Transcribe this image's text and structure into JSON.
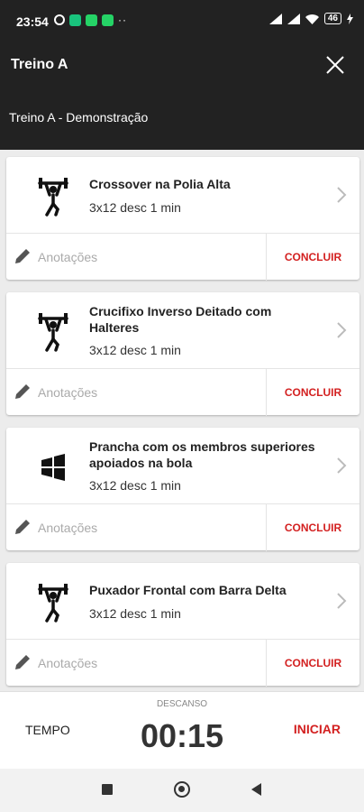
{
  "status_bar": {
    "time": "23:54",
    "battery": "46",
    "icons": [
      "alarm-icon",
      "green-app-icon",
      "whatsapp-icon",
      "whatsapp-icon",
      "more-dots",
      "signal-icon",
      "signal-icon",
      "wifi-icon",
      "battery-icon",
      "charging-icon"
    ]
  },
  "header": {
    "title": "Treino A",
    "subtitle": "Treino A - Demonstração"
  },
  "exercises": [
    {
      "name": "Crossover na Polia Alta",
      "detail": "3x12 desc 1 min",
      "notes_placeholder": "Anotações",
      "action": "CONCLUIR",
      "icon": "weightlifter-icon"
    },
    {
      "name": "Crucifixo Inverso Deitado  com Halteres",
      "detail": "3x12 desc 1 min",
      "notes_placeholder": "Anotações",
      "action": "CONCLUIR",
      "icon": "weightlifter-icon"
    },
    {
      "name": "Prancha com os membros superiores apoiados na bola",
      "detail": "3x12 desc 1 min",
      "notes_placeholder": "Anotações",
      "action": "CONCLUIR",
      "icon": "windows-grid-icon"
    },
    {
      "name": "Puxador Frontal com Barra Delta",
      "detail": "3x12 desc 1 min",
      "notes_placeholder": "Anotações",
      "action": "CONCLUIR",
      "icon": "weightlifter-icon"
    }
  ],
  "timer": {
    "rest_label": "DESCANSO",
    "tempo_label": "TEMPO",
    "time": "00:15",
    "start_label": "INICIAR"
  },
  "colors": {
    "header_bg": "#222222",
    "accent": "#d32020",
    "background": "#ececec"
  }
}
